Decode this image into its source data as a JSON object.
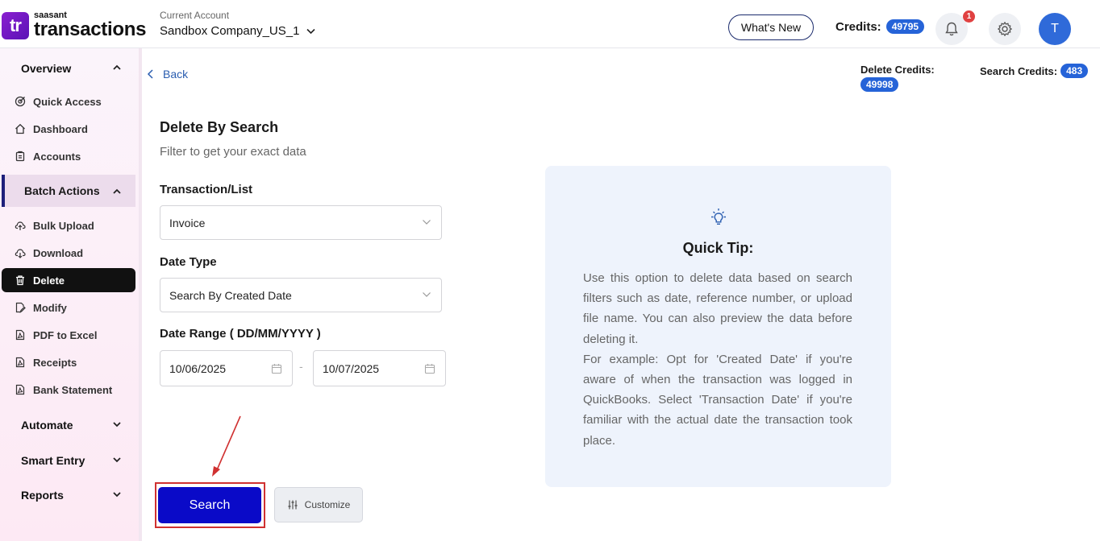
{
  "app": {
    "logo_mark": "tr",
    "logo_small": "saasant",
    "logo_big": "transactions"
  },
  "header": {
    "account_label": "Current Account",
    "account_name": "Sandbox Company_US_1",
    "whats_new": "What's New",
    "credits_label": "Credits:",
    "credits_value": "49795",
    "notification_count": "1",
    "avatar_initial": "T"
  },
  "sidebar": {
    "overview": "Overview",
    "overview_items": [
      "Quick Access",
      "Dashboard",
      "Accounts"
    ],
    "batch_actions": "Batch Actions",
    "batch_items": [
      "Bulk Upload",
      "Download",
      "Delete",
      "Modify",
      "PDF to Excel",
      "Receipts",
      "Bank Statement"
    ],
    "automate": "Automate",
    "smart_entry": "Smart Entry",
    "reports": "Reports"
  },
  "main": {
    "back": "Back",
    "delete_credits_label": "Delete Credits:",
    "delete_credits_value": "49998",
    "search_credits_label": "Search Credits:",
    "search_credits_value": "483",
    "title": "Delete By Search",
    "subtitle": "Filter to get your exact data",
    "transaction_label": "Transaction/List",
    "transaction_value": "Invoice",
    "date_type_label": "Date Type",
    "date_type_value": "Search By Created Date",
    "date_range_label": "Date Range ( DD/MM/YYYY )",
    "date_from": "10/06/2025",
    "date_separator": "-",
    "date_to": "10/07/2025",
    "search_button": "Search",
    "customize_button": "Customize"
  },
  "tip": {
    "title": "Quick Tip:",
    "paragraph1": "Use this option to delete data based on search filters such as date, reference number, or upload file name. You can also preview the data before deleting it.",
    "paragraph2": "For example: Opt for 'Created Date' if you're aware of when the transaction was logged in QuickBooks. Select 'Transaction Date' if you're familiar with the actual date the transaction took place."
  },
  "colors": {
    "primary_button": "#0a0ac8",
    "credit_pill": "#2563d8",
    "highlight_outline": "#d03131",
    "active_nav": "#111111"
  }
}
